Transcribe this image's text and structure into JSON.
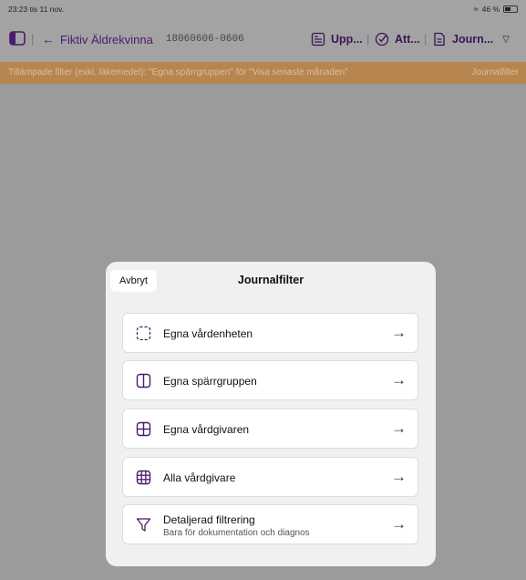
{
  "status": {
    "time": "23:23  tis 11 nov.",
    "battery": "46 %"
  },
  "nav": {
    "back_label": "Fiktiv Äldrekvinna",
    "patient_id": "18060606-0606",
    "tools": [
      {
        "label": "Upp...",
        "icon": "document-list-icon"
      },
      {
        "label": "Att...",
        "icon": "check-circle-icon"
      },
      {
        "label": "Journ...",
        "icon": "document-icon"
      }
    ]
  },
  "filterbar": {
    "text": "Tillämpade filter (exkl. läkemedel): \"Egna spärrgruppen\" för \"Visa senaste månaden\"",
    "link": "Journalfilter"
  },
  "modal": {
    "cancel": "Avbryt",
    "title": "Journalfilter",
    "options": [
      {
        "label": "Egna vårdenheten",
        "icon": "dashed-square-icon"
      },
      {
        "label": "Egna spärrgruppen",
        "icon": "split-square-icon"
      },
      {
        "label": "Egna vårdgivaren",
        "icon": "quad-grid-icon"
      },
      {
        "label": "Alla vårdgivare",
        "icon": "nine-grid-icon"
      },
      {
        "label": "Detaljerad filtrering",
        "sublabel": "Bara för dokumentation och diagnos",
        "icon": "filter-icon"
      }
    ]
  },
  "colors": {
    "accent": "#4a1a6e",
    "filterbar": "#b7864f",
    "overlay": "#9b9b9b"
  }
}
